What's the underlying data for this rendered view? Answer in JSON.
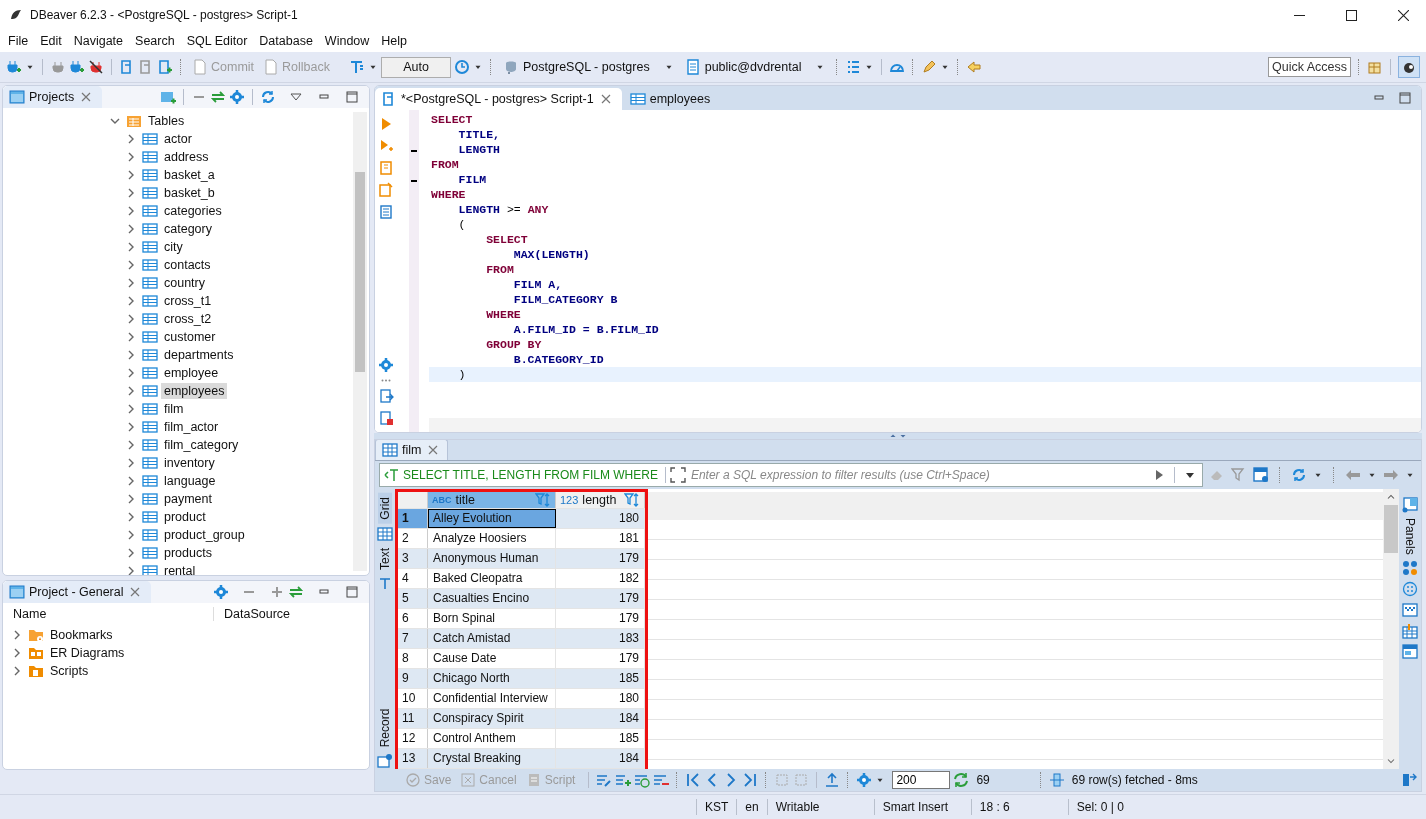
{
  "window": {
    "title": "DBeaver 6.2.3 - <PostgreSQL - postgres> Script-1"
  },
  "menu": [
    "File",
    "Edit",
    "Navigate",
    "Search",
    "SQL Editor",
    "Database",
    "Window",
    "Help"
  ],
  "toolbar": {
    "commit": {
      "label": "Commit",
      "disabled": true
    },
    "rollback": {
      "label": "Rollback",
      "disabled": true
    },
    "mode": "Auto",
    "connection": "PostgreSQL - postgres",
    "schema": "public@dvdrental",
    "quick_access": "Quick Access"
  },
  "projects": {
    "tab": "Projects",
    "folder": {
      "label": "Tables",
      "expanded": true,
      "children": [
        {
          "label": "actor",
          "selected": false,
          "expanded": false
        },
        {
          "label": "address",
          "selected": false,
          "expanded": false
        },
        {
          "label": "basket_a",
          "selected": false,
          "expanded": false
        },
        {
          "label": "basket_b",
          "selected": false,
          "expanded": false
        },
        {
          "label": "categories",
          "selected": false,
          "expanded": false
        },
        {
          "label": "category",
          "selected": false,
          "expanded": false
        },
        {
          "label": "city",
          "selected": false,
          "expanded": false
        },
        {
          "label": "contacts",
          "selected": false,
          "expanded": false
        },
        {
          "label": "country",
          "selected": false,
          "expanded": false
        },
        {
          "label": "cross_t1",
          "selected": false,
          "expanded": false
        },
        {
          "label": "cross_t2",
          "selected": false,
          "expanded": false
        },
        {
          "label": "customer",
          "selected": false,
          "expanded": false
        },
        {
          "label": "departments",
          "selected": false,
          "expanded": false
        },
        {
          "label": "employee",
          "selected": false,
          "expanded": false
        },
        {
          "label": "employees",
          "selected": true,
          "expanded": false
        },
        {
          "label": "film",
          "selected": false,
          "expanded": false
        },
        {
          "label": "film_actor",
          "selected": false,
          "expanded": false
        },
        {
          "label": "film_category",
          "selected": false,
          "expanded": false
        },
        {
          "label": "inventory",
          "selected": false,
          "expanded": false
        },
        {
          "label": "language",
          "selected": false,
          "expanded": false
        },
        {
          "label": "payment",
          "selected": false,
          "expanded": false
        },
        {
          "label": "product",
          "selected": false,
          "expanded": false
        },
        {
          "label": "product_group",
          "selected": false,
          "expanded": false
        },
        {
          "label": "products",
          "selected": false,
          "expanded": false
        },
        {
          "label": "rental",
          "selected": false,
          "expanded": false
        }
      ]
    }
  },
  "project_general": {
    "tab": "Project - General",
    "columns": [
      "Name",
      "DataSource"
    ],
    "items": [
      {
        "label": "Bookmarks",
        "kind": "bookmarks",
        "expanded": false
      },
      {
        "label": "ER Diagrams",
        "kind": "diagrams",
        "expanded": false
      },
      {
        "label": "Scripts",
        "kind": "scripts",
        "expanded": false
      }
    ]
  },
  "editor": {
    "tabs": [
      {
        "label": "*<PostgreSQL - postgres> Script-1",
        "kind": "script",
        "selected": true
      },
      {
        "label": "employees",
        "kind": "table",
        "selected": false
      }
    ],
    "lines": [
      {
        "tokens": [
          {
            "text": "SELECT",
            "kind": "keyword"
          }
        ]
      },
      {
        "tokens": [
          {
            "text": "    TITLE,",
            "kind": "name"
          }
        ]
      },
      {
        "tokens": [
          {
            "text": "    LENGTH",
            "kind": "name"
          }
        ]
      },
      {
        "tokens": [
          {
            "text": "FROM",
            "kind": "keyword"
          }
        ]
      },
      {
        "tokens": [
          {
            "text": "    FILM",
            "kind": "name"
          }
        ]
      },
      {
        "tokens": [
          {
            "text": "WHERE",
            "kind": "keyword"
          }
        ]
      },
      {
        "tokens": [
          {
            "text": "    LENGTH",
            "kind": "name"
          },
          {
            "text": " >= ",
            "kind": "plain"
          },
          {
            "text": "ANY",
            "kind": "keyword"
          }
        ]
      },
      {
        "tokens": [
          {
            "text": "    (",
            "kind": "plain"
          }
        ]
      },
      {
        "tokens": [
          {
            "text": "        SELECT",
            "kind": "keyword"
          }
        ]
      },
      {
        "tokens": [
          {
            "text": "            MAX(LENGTH)",
            "kind": "name"
          }
        ]
      },
      {
        "tokens": [
          {
            "text": "        FROM",
            "kind": "keyword"
          }
        ]
      },
      {
        "tokens": [
          {
            "text": "            FILM A,",
            "kind": "name"
          }
        ]
      },
      {
        "tokens": [
          {
            "text": "            FILM_CATEGORY B",
            "kind": "name"
          }
        ]
      },
      {
        "tokens": [
          {
            "text": "        WHERE",
            "kind": "keyword"
          }
        ]
      },
      {
        "tokens": [
          {
            "text": "            A.FILM_ID = B.FILM_ID",
            "kind": "name"
          }
        ]
      },
      {
        "tokens": [
          {
            "text": "        GROUP BY",
            "kind": "keyword"
          }
        ]
      },
      {
        "tokens": [
          {
            "text": "            B.CATEGORY_ID",
            "kind": "name"
          }
        ]
      },
      {
        "tokens": [
          {
            "text": "    )",
            "kind": "plain"
          }
        ],
        "current": true
      }
    ]
  },
  "results": {
    "tab": "film",
    "query": "SELECT TITLE, LENGTH FROM FILM WHERE",
    "filter_placeholder": "Enter a SQL expression to filter results (use Ctrl+Space)",
    "views": [
      {
        "label": "Grid",
        "selected": true
      },
      {
        "label": "Text",
        "selected": false
      },
      {
        "label": "Record",
        "selected": false
      }
    ],
    "highlighted": true,
    "columns": [
      {
        "label": "title",
        "type": "ABC"
      },
      {
        "label": "length",
        "type": "123"
      }
    ],
    "rows": [
      {
        "number": "1",
        "cells": [
          "Alley Evolution",
          "180"
        ],
        "selected": true
      },
      {
        "number": "2",
        "cells": [
          "Analyze Hoosiers",
          "181"
        ],
        "selected": false
      },
      {
        "number": "3",
        "cells": [
          "Anonymous Human",
          "179"
        ],
        "selected": false
      },
      {
        "number": "4",
        "cells": [
          "Baked Cleopatra",
          "182"
        ],
        "selected": false
      },
      {
        "number": "5",
        "cells": [
          "Casualties Encino",
          "179"
        ],
        "selected": false
      },
      {
        "number": "6",
        "cells": [
          "Born Spinal",
          "179"
        ],
        "selected": false
      },
      {
        "number": "7",
        "cells": [
          "Catch Amistad",
          "183"
        ],
        "selected": false
      },
      {
        "number": "8",
        "cells": [
          "Cause Date",
          "179"
        ],
        "selected": false
      },
      {
        "number": "9",
        "cells": [
          "Chicago North",
          "185"
        ],
        "selected": false
      },
      {
        "number": "10",
        "cells": [
          "Confidential Interview",
          "180"
        ],
        "selected": false
      },
      {
        "number": "11",
        "cells": [
          "Conspiracy Spirit",
          "184"
        ],
        "selected": false
      },
      {
        "number": "12",
        "cells": [
          "Control Anthem",
          "185"
        ],
        "selected": false
      },
      {
        "number": "13",
        "cells": [
          "Crystal Breaking",
          "184"
        ],
        "selected": false
      }
    ],
    "panels": "Panels",
    "actions": [
      {
        "label": "Save",
        "disabled": true
      },
      {
        "label": "Cancel",
        "disabled": true
      },
      {
        "label": "Script",
        "disabled": true
      }
    ],
    "fetch_size": "200",
    "refresh_count": "69",
    "fetched": "69 row(s) fetched - 8ms"
  },
  "status_bar": [
    "KST",
    "en",
    "Writable",
    "Smart Insert",
    "18 : 6",
    "Sel: 0 | 0"
  ]
}
